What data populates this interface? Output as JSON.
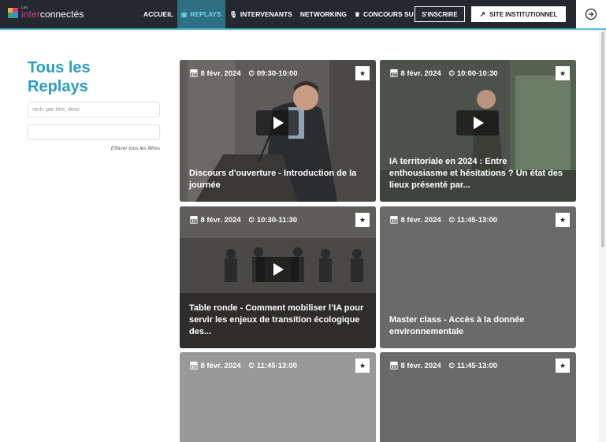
{
  "brand": {
    "les": "Les",
    "part1": "inter",
    "part2": "connectés"
  },
  "nav": {
    "items": [
      {
        "label": "ACCUEIL",
        "icon": ""
      },
      {
        "label": "REPLAYS",
        "icon": "play-square-icon"
      },
      {
        "label": "INTERVENANTS",
        "icon": "microphone-icon"
      },
      {
        "label": "NETWORKING",
        "icon": ""
      },
      {
        "label": "CONCOURS SU",
        "icon": "trophy-icon"
      }
    ],
    "register_label": "S'INSCRIRE",
    "site_label": "SITE INSTITUTIONNEL",
    "login_icon": "login-icon"
  },
  "sidebar": {
    "title": "Tous les Replays",
    "search_placeholder": "rech. par titre, desc.",
    "clear_filters": "Effacer tous les filtres"
  },
  "cards": [
    {
      "date": "8 févr. 2024",
      "time": "09:30-10:00",
      "title": "Discours d'ouverture - Introduction de la journée",
      "has_video": true
    },
    {
      "date": "8 févr. 2024",
      "time": "10:00-10:30",
      "title": "IA territoriale en 2024 : Entre enthousiasme et hésitations ? Un état des lieux présenté par...",
      "has_video": true
    },
    {
      "date": "8 févr. 2024",
      "time": "10:30-11:30",
      "title": "Table ronde - Comment mobiliser l’IA pour servir les enjeux de transition écologique des...",
      "has_video": true
    },
    {
      "date": "8 févr. 2024",
      "time": "11:45-13:00",
      "title": "Master class - Accès à la donnée environnementale",
      "has_video": false
    },
    {
      "date": "8 févr. 2024",
      "time": "11:45-13:00",
      "title": "",
      "has_video": false
    },
    {
      "date": "8 févr. 2024",
      "time": "11:45-13:00",
      "title": "",
      "has_video": false
    }
  ],
  "colors": {
    "accent": "#2a9ec6",
    "header_bg": "#24292f",
    "brand_pink": "#d6388b"
  }
}
